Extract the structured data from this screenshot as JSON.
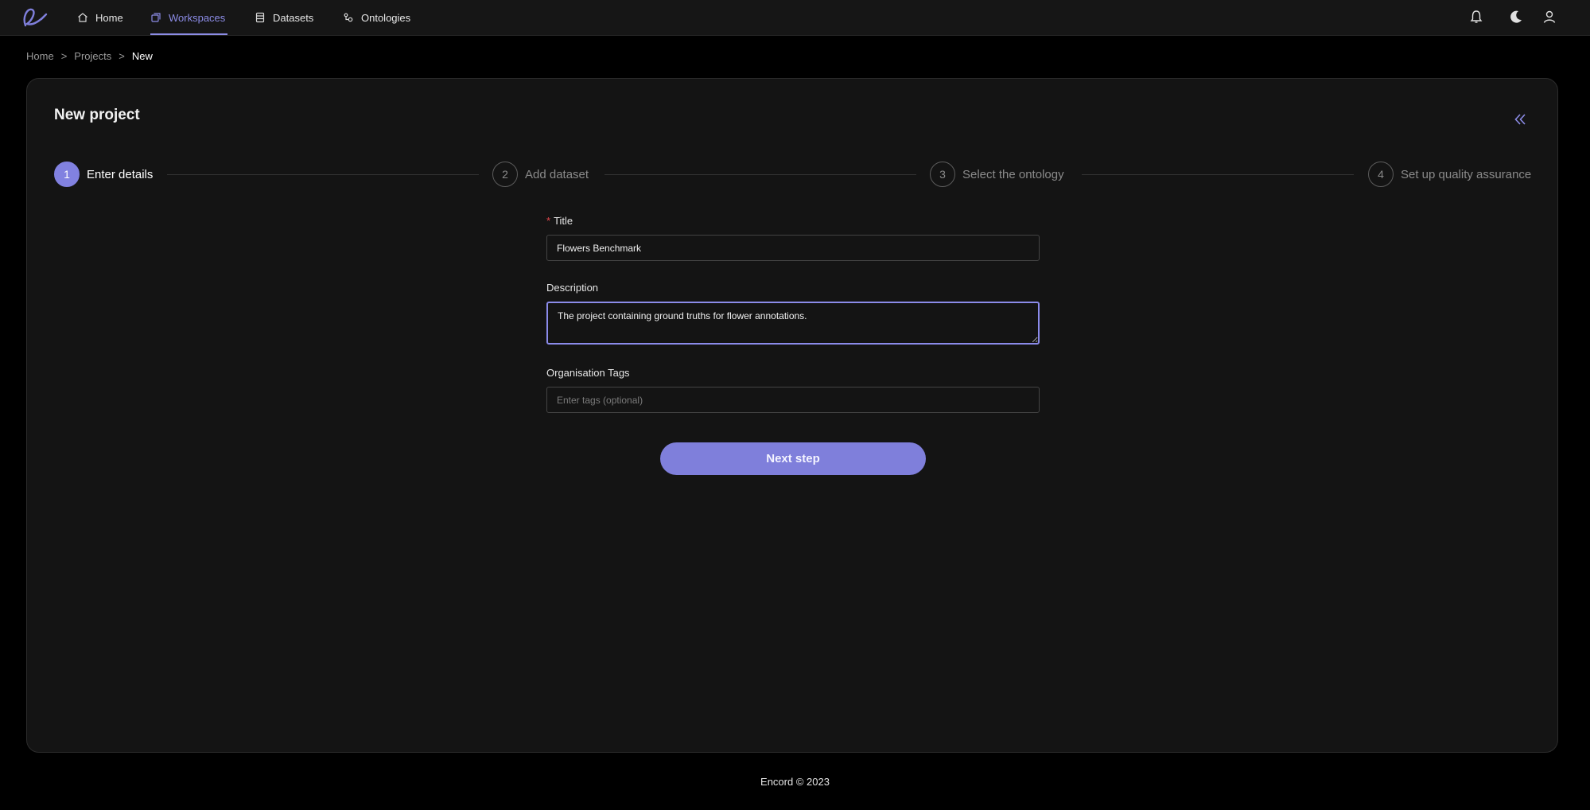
{
  "nav": {
    "items": [
      {
        "label": "Home",
        "icon": "home-icon"
      },
      {
        "label": "Workspaces",
        "icon": "workspaces-icon",
        "active": true
      },
      {
        "label": "Datasets",
        "icon": "datasets-icon"
      },
      {
        "label": "Ontologies",
        "icon": "ontologies-icon"
      }
    ],
    "right_icons": [
      "bell-icon",
      "moon-icon",
      "user-icon"
    ],
    "accent_color": "#8c8ce6"
  },
  "breadcrumb": {
    "items": [
      "Home",
      "Projects",
      "New"
    ],
    "separator": ">"
  },
  "page": {
    "title": "New project",
    "collapse_icon": "double-chevron-left-icon"
  },
  "stepper": {
    "steps": [
      {
        "number": "1",
        "label": "Enter details",
        "active": true
      },
      {
        "number": "2",
        "label": "Add dataset"
      },
      {
        "number": "3",
        "label": "Select the ontology"
      },
      {
        "number": "4",
        "label": "Set up quality assurance"
      }
    ]
  },
  "form": {
    "title_label": "Title",
    "title_required_mark": "*",
    "title_value": "Flowers Benchmark",
    "description_label": "Description",
    "description_value": "The project containing ground truths for flower annotations.",
    "tags_label": "Organisation Tags",
    "tags_placeholder": "Enter tags (optional)",
    "next_button": "Next step"
  },
  "footer": {
    "text": "Encord © 2023"
  }
}
